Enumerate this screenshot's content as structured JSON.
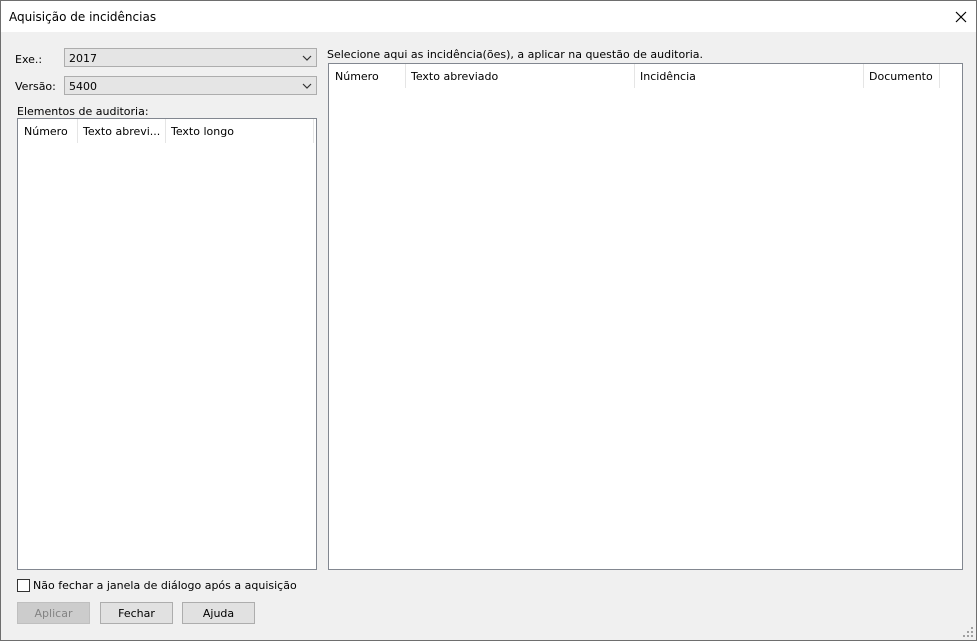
{
  "window": {
    "title": "Aquisição de incidências",
    "close_icon": "×"
  },
  "fields": {
    "exe_label": "Exe.:",
    "exe_value": "2017",
    "versao_label": "Versão:",
    "versao_value": "5400"
  },
  "left_panel": {
    "label": "Elementos de auditoria:",
    "columns": [
      "Número",
      "Texto abrevi...",
      "Texto longo"
    ]
  },
  "right_panel": {
    "label": "Selecione aqui as incidência(ões), a aplicar na questão de auditoria.",
    "columns": [
      "Número",
      "Texto abreviado",
      "Incidência",
      "Documento"
    ]
  },
  "checkbox": {
    "label": "Não fechar a janela de diálogo após a aquisição",
    "checked": false
  },
  "buttons": {
    "apply": "Aplicar",
    "close": "Fechar",
    "help": "Ajuda"
  },
  "colors": {
    "window_bg": "#f0f0f0",
    "list_bg": "#ffffff",
    "disabled_text": "#838383"
  }
}
